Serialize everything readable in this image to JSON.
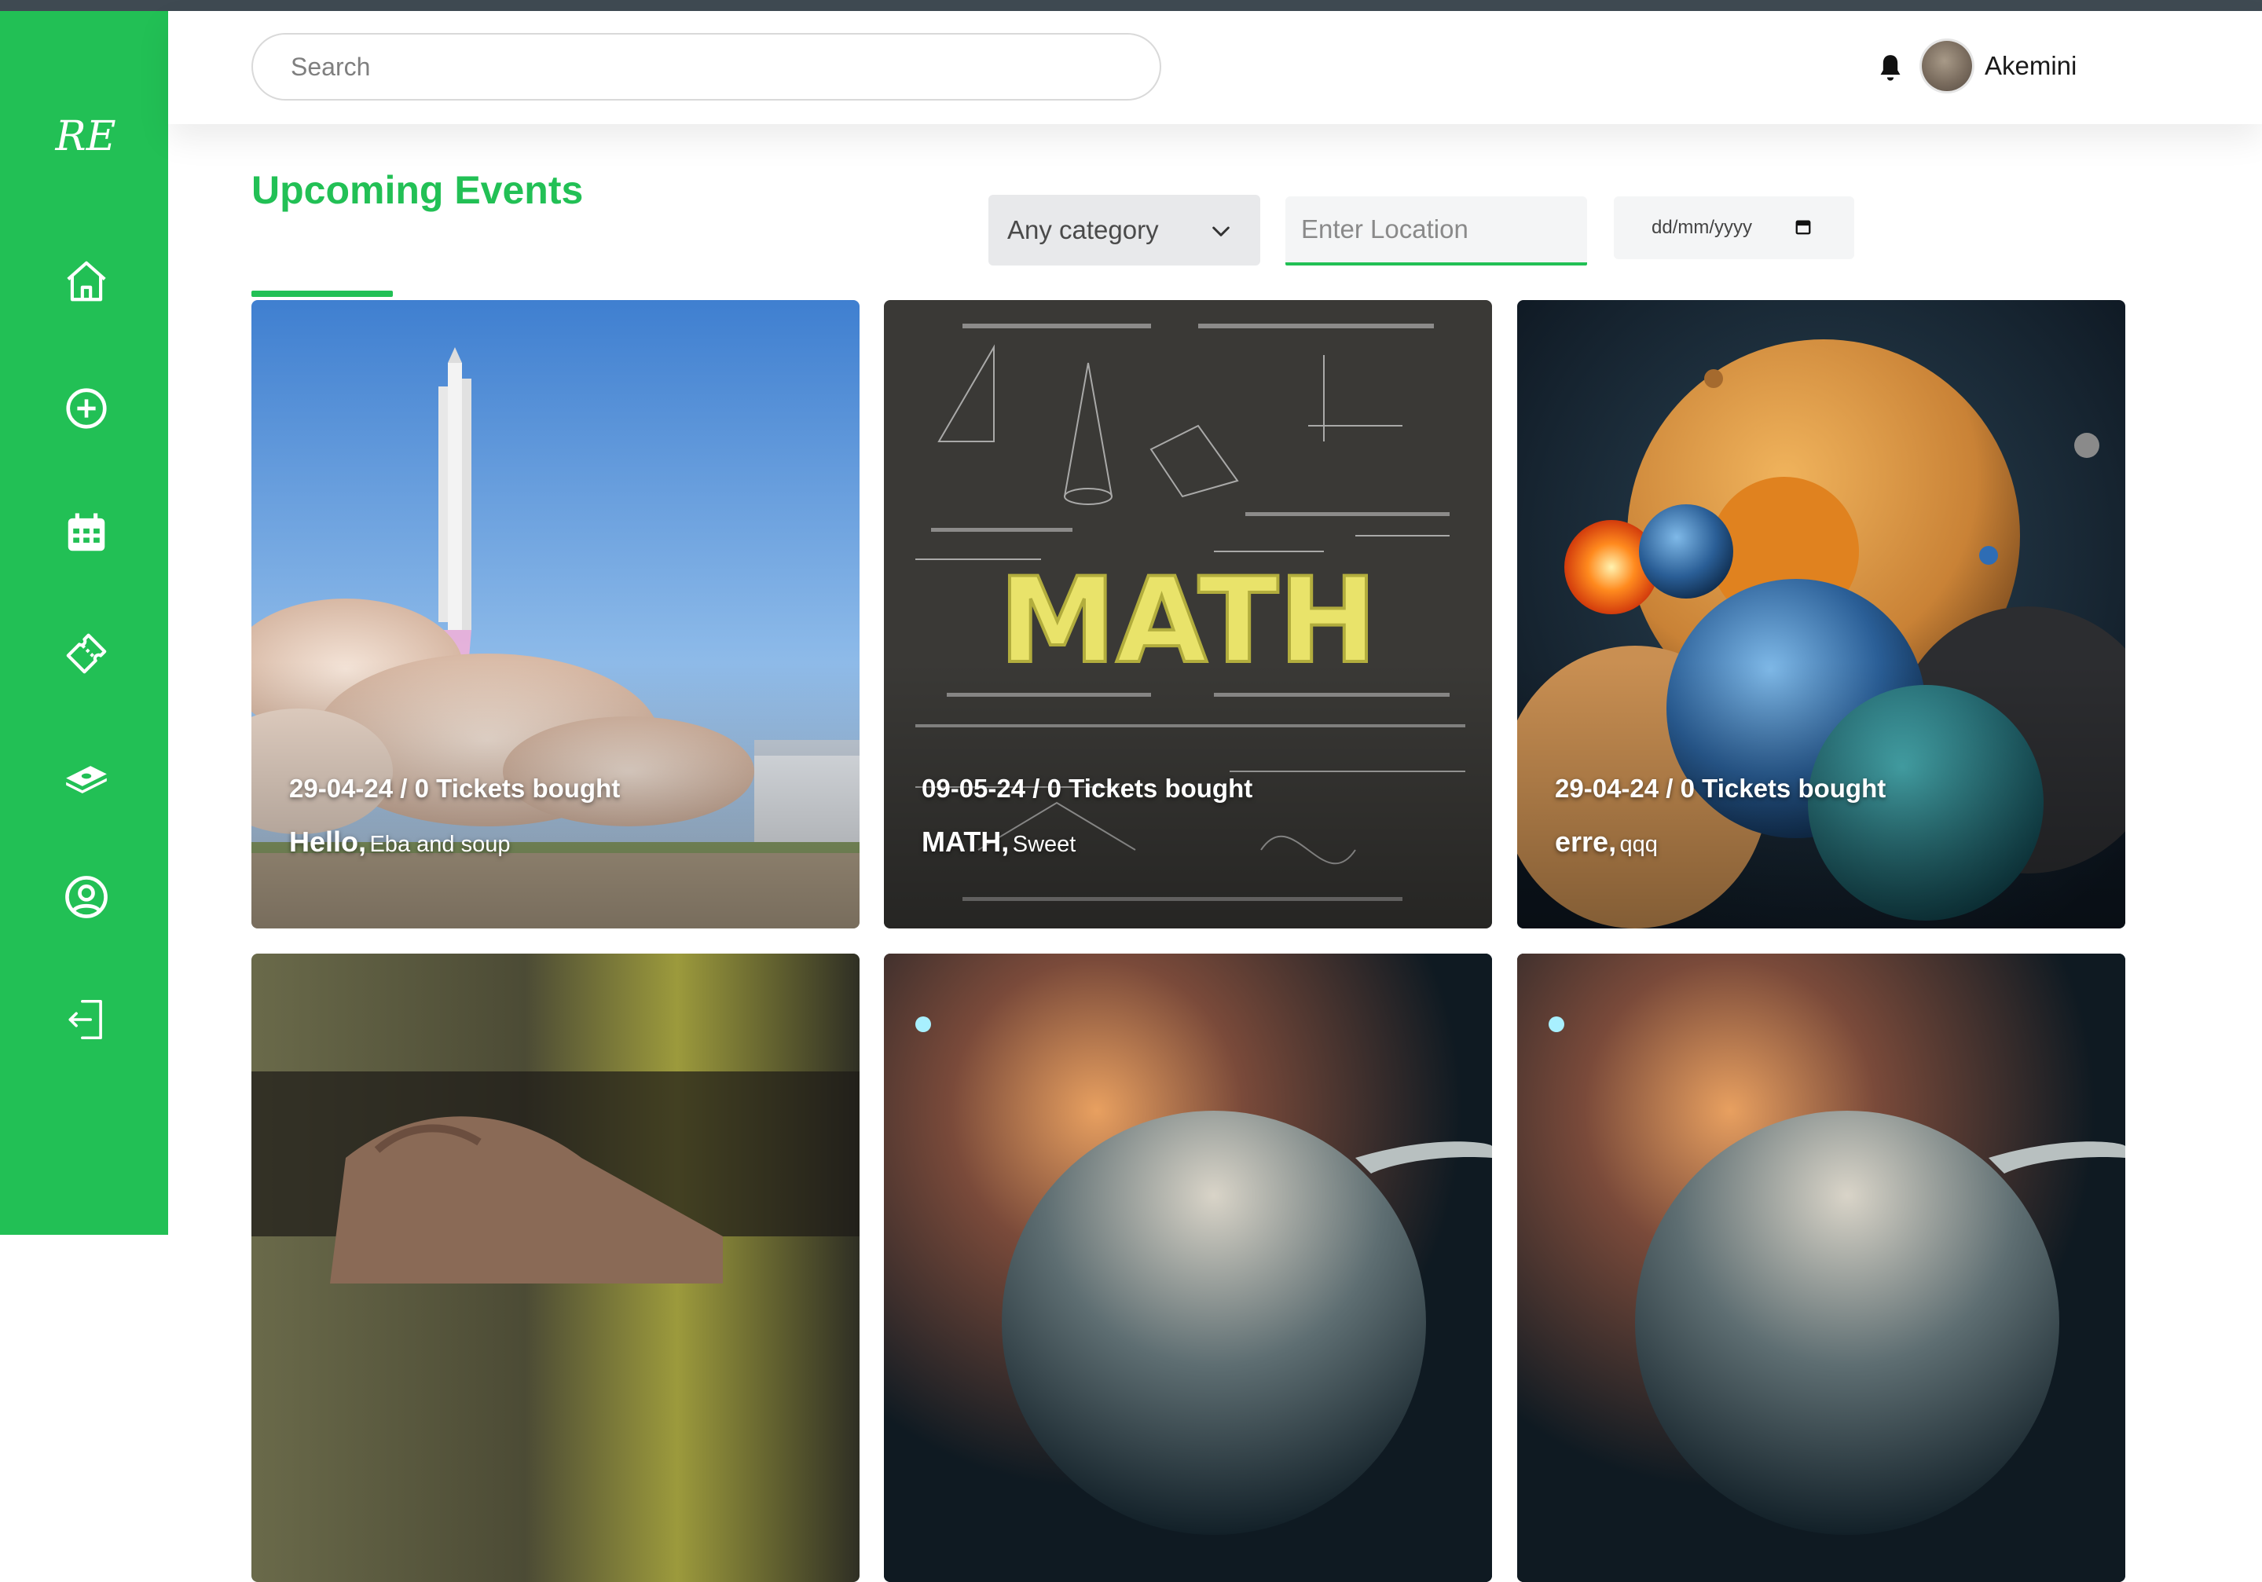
{
  "app": {
    "logo_text": "RE"
  },
  "sidebar": {
    "items": [
      {
        "icon": "home-icon"
      },
      {
        "icon": "add-circle-icon"
      },
      {
        "icon": "calendar-icon"
      },
      {
        "icon": "ticket-icon"
      },
      {
        "icon": "money-icon"
      },
      {
        "icon": "user-circle-icon"
      },
      {
        "icon": "logout-icon"
      }
    ]
  },
  "header": {
    "search_placeholder": "Search",
    "username": "Akemini"
  },
  "main": {
    "title": "Upcoming Events",
    "filters": {
      "category_selected": "Any category",
      "location_placeholder": "Enter Location",
      "date_placeholder": "dd/mm/yyyy"
    },
    "events": [
      {
        "date": "29-04-24",
        "tickets": "0 Tickets bought",
        "name": "Hello,",
        "description": "Eba and soup",
        "image": "rocket-launch"
      },
      {
        "date": "09-05-24",
        "tickets": "0 Tickets bought",
        "name": "MATH,",
        "description": "Sweet",
        "image": "math-chalkboard",
        "image_text": "MATH"
      },
      {
        "date": "29-04-24",
        "tickets": "0 Tickets bought",
        "name": "erre,",
        "description": "qqq",
        "image": "planets"
      },
      {
        "image": "hand-closeup"
      },
      {
        "image": "space-planet"
      },
      {
        "image": "space-planet"
      }
    ]
  },
  "colors": {
    "accent": "#22c055",
    "topbar": "#3f4a52"
  }
}
